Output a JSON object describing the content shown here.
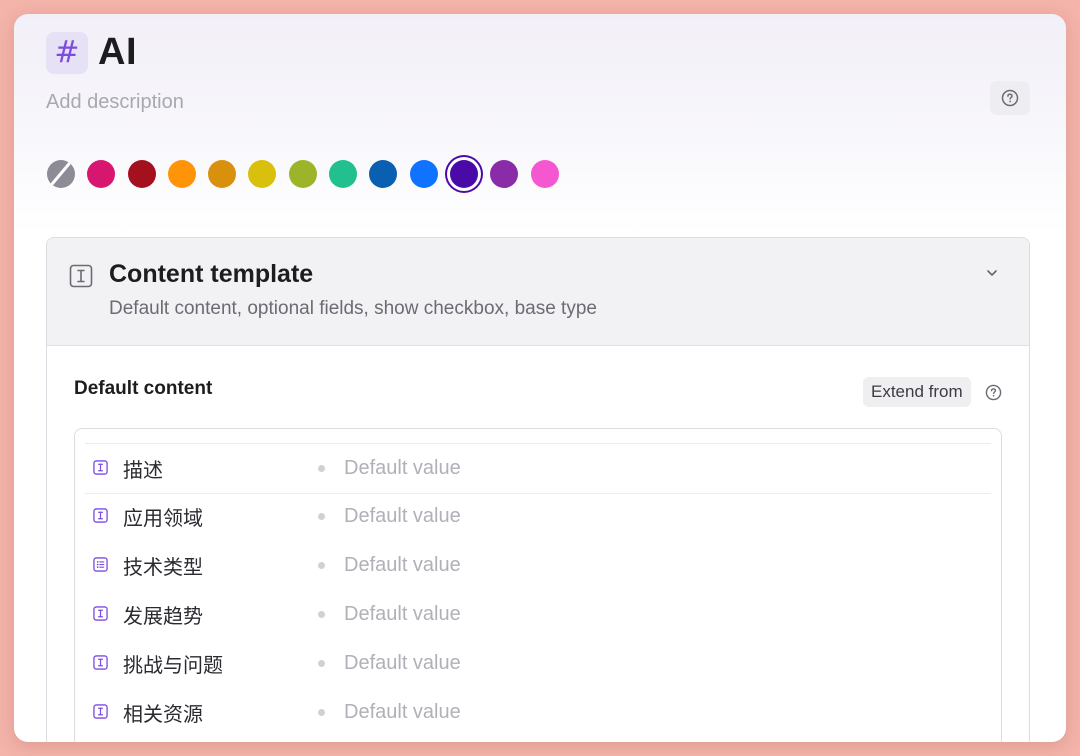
{
  "tag": {
    "icon": "hash-icon",
    "title": "AI",
    "description_placeholder": "Add description"
  },
  "colors": {
    "options": [
      "none",
      "#d6166f",
      "#a5101e",
      "#ff9408",
      "#d9900c",
      "#d9c00c",
      "#9bb42a",
      "#21c08e",
      "#0b5fb0",
      "#0f73ff",
      "#4a0aa8",
      "#8a2ba8",
      "#f557d0"
    ],
    "selected": "#4a0aa8"
  },
  "content_template": {
    "title": "Content template",
    "subtitle": "Default content, optional fields, show checkbox, base type",
    "default_content_label": "Default content",
    "extend_from_label": "Extend from",
    "fields": [
      {
        "name": "描述",
        "icon": "text-field-icon",
        "placeholder": "Default value"
      },
      {
        "name": "应用领域",
        "icon": "text-field-icon",
        "placeholder": "Default value"
      },
      {
        "name": "技术类型",
        "icon": "list-field-icon",
        "placeholder": "Default value"
      },
      {
        "name": "发展趋势",
        "icon": "text-field-icon",
        "placeholder": "Default value"
      },
      {
        "name": "挑战与问题",
        "icon": "text-field-icon",
        "placeholder": "Default value"
      },
      {
        "name": "相关资源",
        "icon": "text-field-icon",
        "placeholder": "Default value"
      }
    ]
  }
}
